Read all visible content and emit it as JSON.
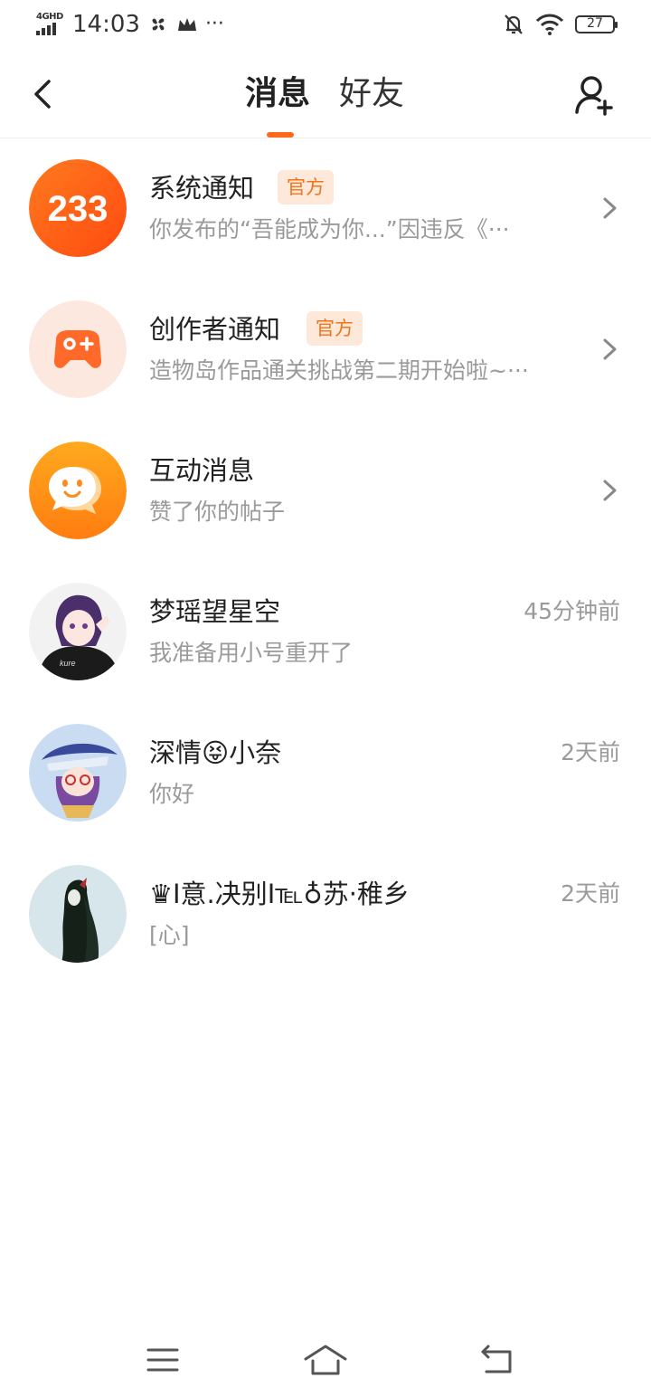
{
  "status_bar": {
    "network": "4GHD",
    "time": "14:03",
    "dots": "···",
    "battery": "27"
  },
  "header": {
    "tab_messages": "消息",
    "tab_friends": "好友"
  },
  "accent_color": "#ff6a1a",
  "messages": [
    {
      "title": "系统通知",
      "badge": "官方",
      "preview": "你发布的“吾能成为你...”因违反《···",
      "avatar_text": "233"
    },
    {
      "title": "创作者通知",
      "badge": "官方",
      "preview": "造物岛作品通关挑战第二期开始啦~···"
    },
    {
      "title": "互动消息",
      "preview": "赞了你的帖子"
    },
    {
      "title": "梦瑶望星空",
      "time": "45分钟前",
      "preview": "我准备用小号重开了"
    },
    {
      "title": "深情😝小奈",
      "time": "2天前",
      "preview": "你好"
    },
    {
      "title": "♛I意.决别I℡♁苏·稚乡",
      "time": "2天前",
      "preview": "[心]"
    }
  ]
}
